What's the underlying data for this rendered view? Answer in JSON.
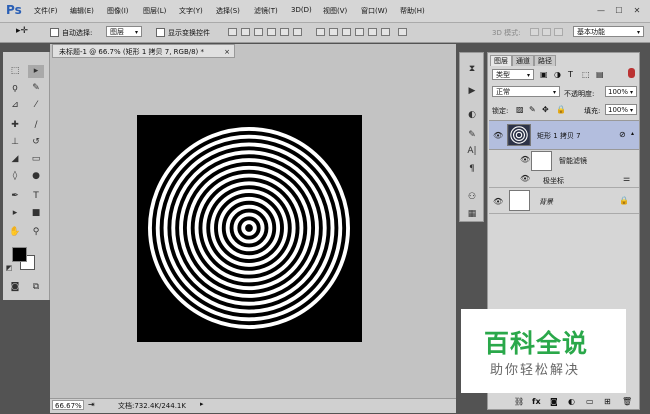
{
  "app": {
    "logo": "Ps"
  },
  "menu": [
    "文件(F)",
    "编辑(E)",
    "图像(I)",
    "图层(L)",
    "文字(Y)",
    "选择(S)",
    "滤镜(T)",
    "3D(D)",
    "视图(V)",
    "窗口(W)",
    "帮助(H)"
  ],
  "window_controls": [
    "—",
    "☐",
    "✕"
  ],
  "options": {
    "auto_select_label": "自动选择:",
    "auto_select_value": "图层",
    "show_transform_label": "显示变换控件",
    "mode_3d_label": "3D 模式:",
    "workspace_value": "基本功能"
  },
  "document": {
    "tab_title": "未标题-1 @ 66.7% (矩形 1 拷贝 7, RGB/8) *",
    "tab_close": "×",
    "ring_count": 13
  },
  "status": {
    "zoom": "66.67%",
    "docinfo": "文档:732.4K/244.1K"
  },
  "panel": {
    "tabs": [
      "图层",
      "通道",
      "路径"
    ],
    "filter_kind": "类型",
    "blend_mode": "正常",
    "opacity_label": "不透明度:",
    "opacity_value": "100%",
    "lock_label": "锁定:",
    "fill_label": "填充:",
    "fill_value": "100%",
    "layers": [
      {
        "name": "矩形 1 拷贝 7",
        "selected": true
      },
      {
        "name": "智能滤镜"
      },
      {
        "name": "极坐标"
      },
      {
        "name": "背景"
      }
    ],
    "footer_icons": [
      "link-icon",
      "fx-icon",
      "mask-icon",
      "adjustment-icon",
      "group-icon",
      "new-layer-icon",
      "trash-icon"
    ]
  },
  "watermark": {
    "title": "百科全说",
    "subtitle": "助你轻松解决",
    "color": "#2aa84a"
  }
}
